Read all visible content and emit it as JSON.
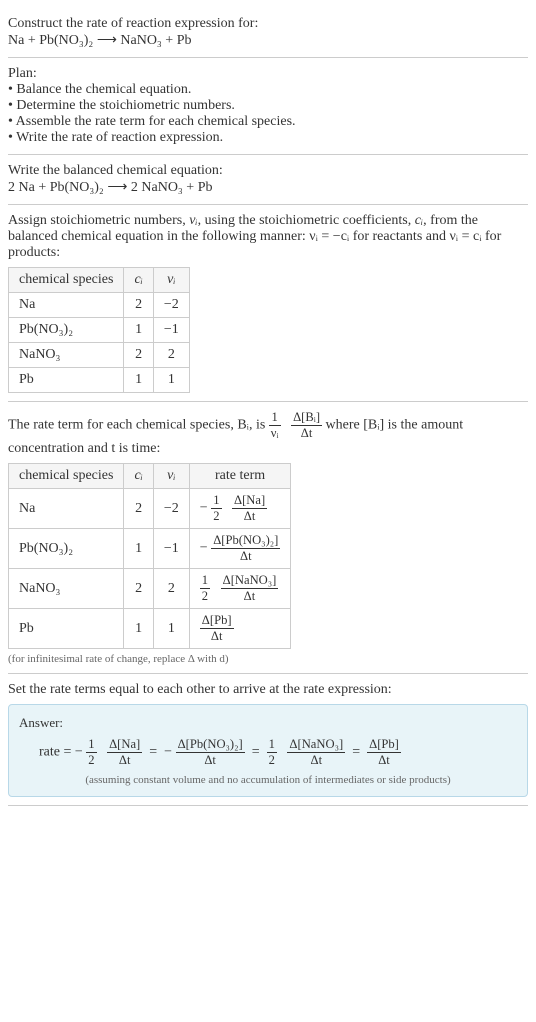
{
  "q": {
    "prompt": "Construct the rate of reaction expression for:",
    "eq": "Na + Pb(NO₃)₂  ⟶  NaNO₃ + Pb"
  },
  "plan": {
    "heading": "Plan:",
    "items": [
      "Balance the chemical equation.",
      "Determine the stoichiometric numbers.",
      "Assemble the rate term for each chemical species.",
      "Write the rate of reaction expression."
    ]
  },
  "balanced": {
    "heading": "Write the balanced chemical equation:",
    "eq": "2 Na + Pb(NO₃)₂  ⟶  2 NaNO₃ + Pb"
  },
  "stoich": {
    "heading_pre": "Assign stoichiometric numbers, ",
    "vi": "νᵢ",
    "heading_mid": ", using the stoichiometric coefficients, ",
    "ci": "cᵢ",
    "heading_post": ", from the balanced chemical equation in the following manner: νᵢ = −cᵢ for reactants and νᵢ = cᵢ for products:",
    "headers": [
      "chemical species",
      "cᵢ",
      "νᵢ"
    ],
    "rows": [
      {
        "sp": "Na",
        "c": "2",
        "v": "−2"
      },
      {
        "sp": "Pb(NO₃)₂",
        "c": "1",
        "v": "−1"
      },
      {
        "sp": "NaNO₃",
        "c": "2",
        "v": "2"
      },
      {
        "sp": "Pb",
        "c": "1",
        "v": "1"
      }
    ]
  },
  "rateterm": {
    "heading_pre": "The rate term for each chemical species, Bᵢ, is ",
    "frac1_num": "1",
    "frac1_den": "νᵢ",
    "frac2_num": "Δ[Bᵢ]",
    "frac2_den": "Δt",
    "heading_post": " where [Bᵢ] is the amount concentration and t is time:",
    "headers": [
      "chemical species",
      "cᵢ",
      "νᵢ",
      "rate term"
    ],
    "rows": [
      {
        "sp": "Na",
        "c": "2",
        "v": "−2",
        "neg": "−",
        "coef_num": "1",
        "coef_den": "2",
        "dnum": "Δ[Na]",
        "dden": "Δt"
      },
      {
        "sp": "Pb(NO₃)₂",
        "c": "1",
        "v": "−1",
        "neg": "−",
        "coef_num": "",
        "coef_den": "",
        "dnum": "Δ[Pb(NO₃)₂]",
        "dden": "Δt"
      },
      {
        "sp": "NaNO₃",
        "c": "2",
        "v": "2",
        "neg": "",
        "coef_num": "1",
        "coef_den": "2",
        "dnum": "Δ[NaNO₃]",
        "dden": "Δt"
      },
      {
        "sp": "Pb",
        "c": "1",
        "v": "1",
        "neg": "",
        "coef_num": "",
        "coef_den": "",
        "dnum": "Δ[Pb]",
        "dden": "Δt"
      }
    ],
    "note": "(for infinitesimal rate of change, replace Δ with d)"
  },
  "setequal": {
    "heading": "Set the rate terms equal to each other to arrive at the rate expression:"
  },
  "answer": {
    "label": "Answer:",
    "rate_prefix": "rate = ",
    "terms": [
      {
        "neg": "−",
        "coef_num": "1",
        "coef_den": "2",
        "dnum": "Δ[Na]",
        "dden": "Δt"
      },
      {
        "neg": "−",
        "coef_num": "",
        "coef_den": "",
        "dnum": "Δ[Pb(NO₃)₂]",
        "dden": "Δt"
      },
      {
        "neg": "",
        "coef_num": "1",
        "coef_den": "2",
        "dnum": "Δ[NaNO₃]",
        "dden": "Δt"
      },
      {
        "neg": "",
        "coef_num": "",
        "coef_den": "",
        "dnum": "Δ[Pb]",
        "dden": "Δt"
      }
    ],
    "note": "(assuming constant volume and no accumulation of intermediates or side products)"
  }
}
